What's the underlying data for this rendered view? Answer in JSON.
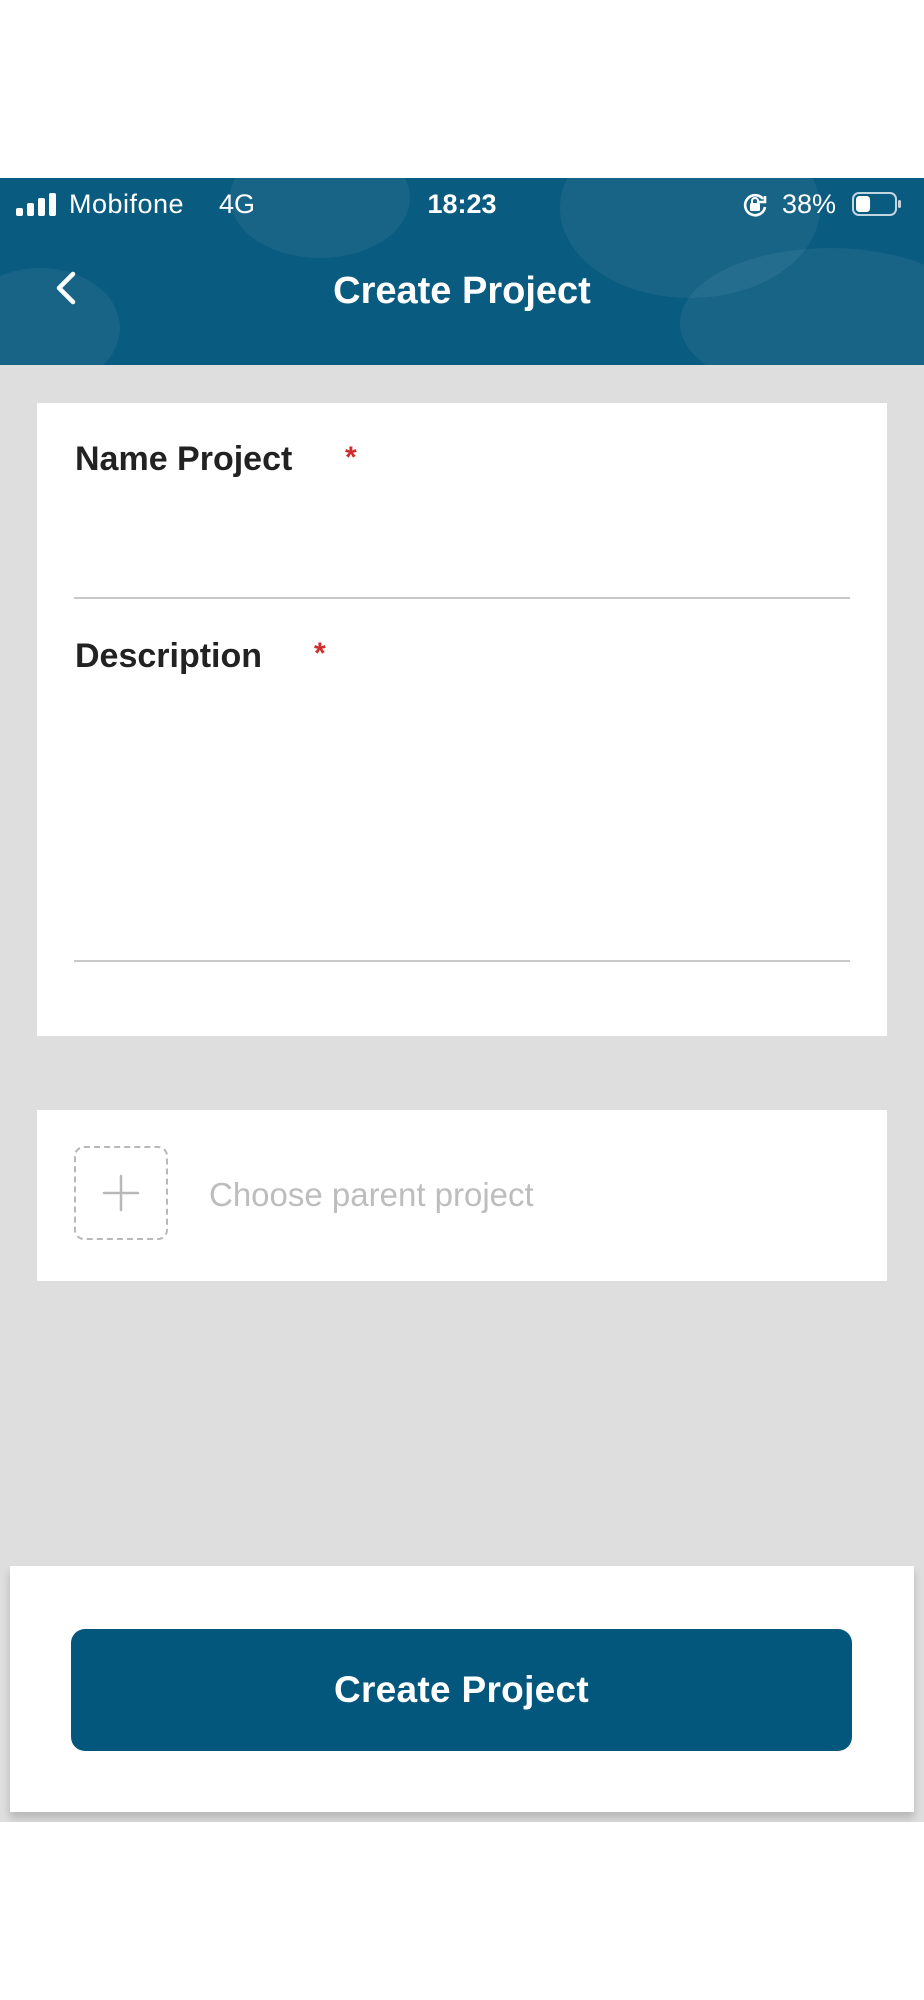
{
  "status_bar": {
    "carrier": "Mobifone",
    "network": "4G",
    "time": "18:23",
    "battery_percent": "38%",
    "battery_level": 0.38
  },
  "header": {
    "title": "Create Project",
    "back_icon": "chevron-left-icon",
    "background_color": "#0a5b80"
  },
  "form": {
    "name_label": "Name Project",
    "name_required": "*",
    "name_value": "",
    "description_label": "Description",
    "description_required": "*",
    "description_value": ""
  },
  "parent_project": {
    "icon": "plus-icon",
    "placeholder": "Choose parent project"
  },
  "footer": {
    "create_button_label": "Create Project",
    "button_color": "#04577c"
  }
}
